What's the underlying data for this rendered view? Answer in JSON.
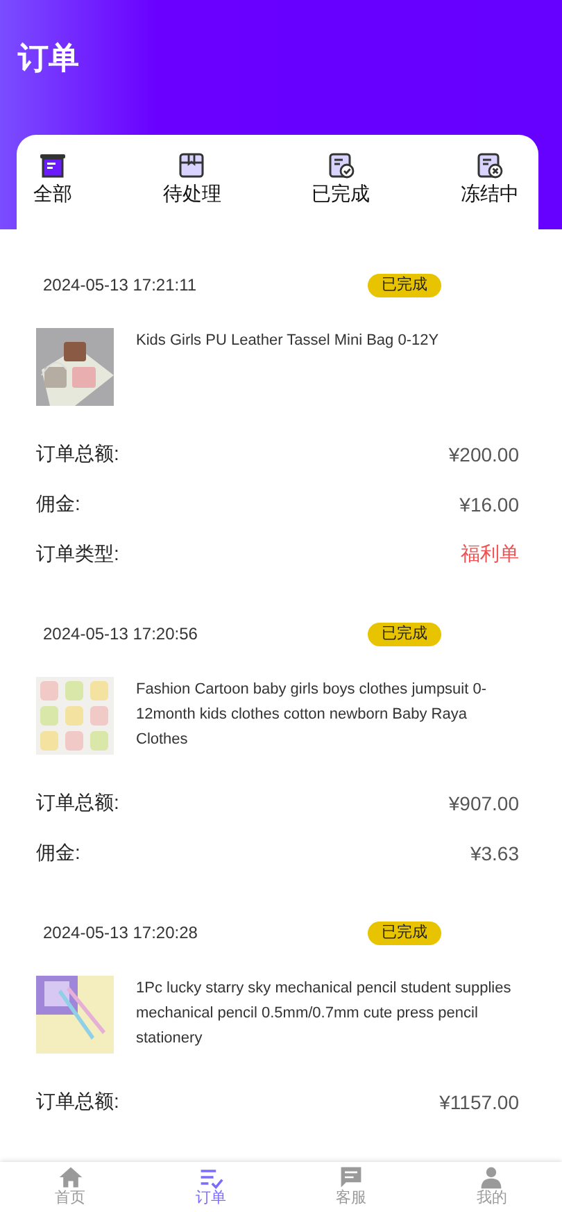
{
  "header": {
    "title": "订单"
  },
  "filters": [
    {
      "label": "全部",
      "selected": true
    },
    {
      "label": "待处理",
      "selected": false
    },
    {
      "label": "已完成",
      "selected": false
    },
    {
      "label": "冻结中",
      "selected": false
    }
  ],
  "orders": [
    {
      "time": "2024-05-13 17:21:11",
      "status": "已完成",
      "product": {
        "kind": "picture",
        "title": "Kids Girls PU Leather Tassel Mini Bag 0-12Y"
      },
      "rows": [
        {
          "label": "订单总额:",
          "value": "¥200.00",
          "highlight": false
        },
        {
          "label": "佣金:",
          "value": "¥16.00",
          "highlight": false
        },
        {
          "label": "订单类型:",
          "value": "福利单",
          "highlight": true
        }
      ]
    },
    {
      "time": "2024-05-13 17:20:56",
      "status": "已完成",
      "product": {
        "kind": "picture",
        "title": "Fashion Cartoon baby girls boys clothes jumpsuit 0-12month kids clothes cotton newborn Baby Raya Clothes"
      },
      "rows": [
        {
          "label": "订单总额:",
          "value": "¥907.00",
          "highlight": false
        },
        {
          "label": "佣金:",
          "value": "¥3.63",
          "highlight": false
        }
      ]
    },
    {
      "time": "2024-05-13 17:20:28",
      "status": "已完成",
      "product": {
        "kind": "picture",
        "title": "1Pc lucky starry sky mechanical pencil student supplies mechanical pencil 0.5mm/0.7mm cute press pencil stationery"
      },
      "rows": [
        {
          "label": "订单总额:",
          "value": "¥1157.00",
          "highlight": false
        }
      ]
    }
  ],
  "bottom_nav": [
    {
      "label": "首页",
      "selected": false
    },
    {
      "label": "订单",
      "selected": true
    },
    {
      "label": "客服",
      "selected": false
    },
    {
      "label": "我的",
      "selected": false
    }
  ]
}
